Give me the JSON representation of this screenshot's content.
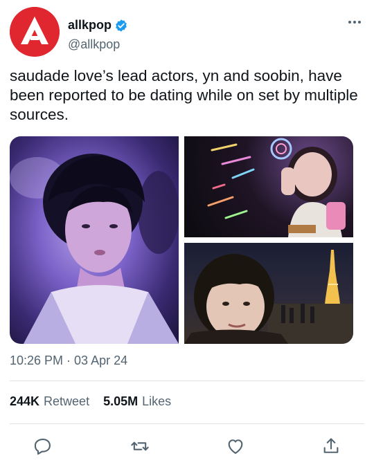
{
  "author": {
    "display_name": "allkpop",
    "handle": "@allkpop",
    "avatar_icon": "allkpop-logo",
    "verified": true,
    "brand_color": "#e0262f"
  },
  "tweet": {
    "text": "saudade love’s lead actors, yn and soobin, have been reported to be dating while on set by multiple sources.",
    "timestamp": "10:26 PM · 03 Apr 24"
  },
  "media": {
    "count": 3,
    "images": [
      {
        "name": "concert-photo"
      },
      {
        "name": "bubble-wand-photo"
      },
      {
        "name": "eiffel-tower-selfie"
      }
    ]
  },
  "stats": {
    "retweets_count": "244K",
    "retweets_label": "Retweet",
    "likes_count": "5.05M",
    "likes_label": "Likes"
  },
  "actions": [
    {
      "icon": "reply-icon"
    },
    {
      "icon": "retweet-icon"
    },
    {
      "icon": "like-icon"
    },
    {
      "icon": "share-icon"
    }
  ],
  "colors": {
    "text": "#0f1419",
    "secondary": "#536471",
    "verified": "#1d9bf0",
    "divider": "#dfe3e6"
  }
}
